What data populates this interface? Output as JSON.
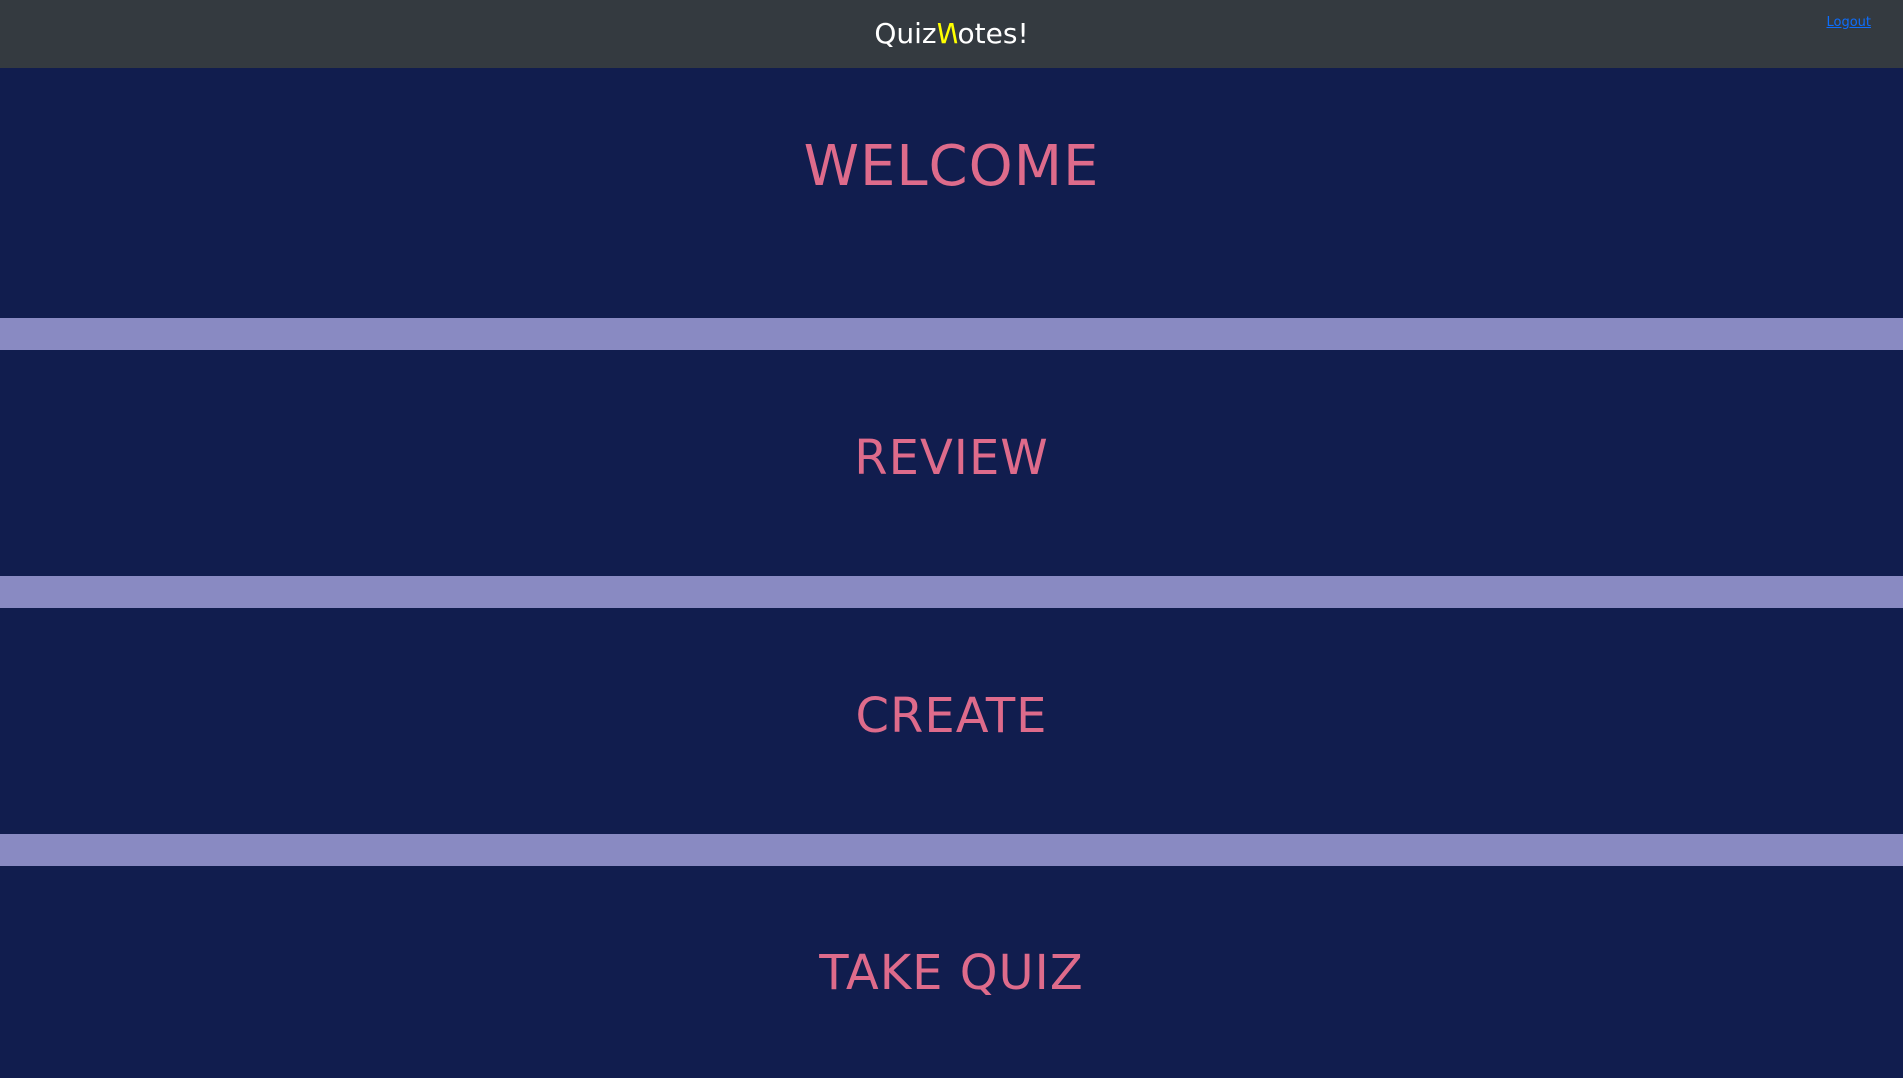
{
  "header": {
    "brand_prefix": "Quiz",
    "brand_accent": "N",
    "brand_suffix": "otes!",
    "logout_label": "Logout"
  },
  "welcome": {
    "title": "WELCOME"
  },
  "menu": {
    "review_label": "REVIEW",
    "create_label": "CREATE",
    "take_quiz_label": "TAKE QUIZ"
  },
  "colors": {
    "page_background": "#111d4e",
    "header_background": "#343a40",
    "divider": "#898ac2",
    "title_text": "#de6b8b",
    "brand_accent": "#ffff00",
    "link": "#0d6efd"
  }
}
